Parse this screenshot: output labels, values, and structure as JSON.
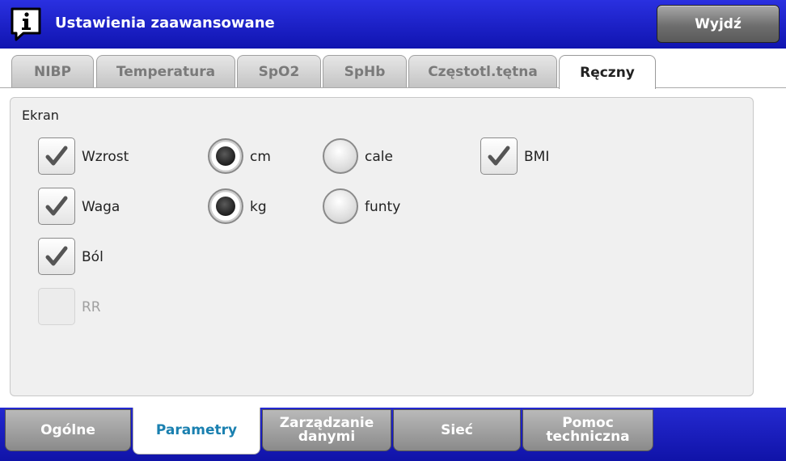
{
  "header": {
    "title": "Ustawienia zaawansowane",
    "exit_label": "Wyjdź"
  },
  "tabs": [
    {
      "label": "NIBP",
      "active": false
    },
    {
      "label": "Temperatura",
      "active": false
    },
    {
      "label": "SpO2",
      "active": false
    },
    {
      "label": "SpHb",
      "active": false
    },
    {
      "label": "Częstotl.tętna",
      "active": false
    },
    {
      "label": "Ręczny",
      "active": true
    }
  ],
  "panel": {
    "section_label": "Ekran",
    "rows": [
      {
        "label": "Wzrost",
        "checked": true,
        "enabled": true
      },
      {
        "label": "Waga",
        "checked": true,
        "enabled": true
      },
      {
        "label": "Ból",
        "checked": true,
        "enabled": true
      },
      {
        "label": "RR",
        "checked": false,
        "enabled": false
      }
    ],
    "height_units": [
      {
        "label": "cm",
        "selected": true
      },
      {
        "label": "cale",
        "selected": false
      }
    ],
    "weight_units": [
      {
        "label": "kg",
        "selected": true
      },
      {
        "label": "funty",
        "selected": false
      }
    ],
    "bmi": {
      "label": "BMI",
      "checked": true
    }
  },
  "bottom_tabs": [
    {
      "line1": "Ogólne",
      "line2": "",
      "active": false
    },
    {
      "line1": "Parametry",
      "line2": "",
      "active": true
    },
    {
      "line1": "Zarządzanie",
      "line2": "danymi",
      "active": false
    },
    {
      "line1": "Sieć",
      "line2": "",
      "active": false
    },
    {
      "line1": "Pomoc",
      "line2": "techniczna",
      "active": false
    }
  ],
  "colors": {
    "header_blue": "#1a1fb8",
    "active_bottom_text": "#1a80b0",
    "check_gray": "#555555"
  }
}
